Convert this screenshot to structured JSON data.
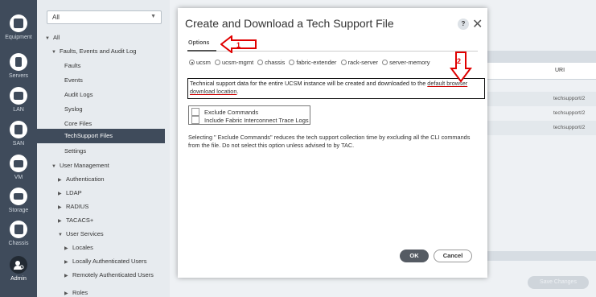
{
  "rail": {
    "items": [
      {
        "label": "Equipment",
        "icon": "equipment-icon"
      },
      {
        "label": "Servers",
        "icon": "servers-icon"
      },
      {
        "label": "LAN",
        "icon": "lan-icon"
      },
      {
        "label": "SAN",
        "icon": "san-icon"
      },
      {
        "label": "VM",
        "icon": "vm-icon"
      },
      {
        "label": "Storage",
        "icon": "storage-icon"
      },
      {
        "label": "Chassis",
        "icon": "chassis-icon"
      },
      {
        "label": "Admin",
        "icon": "admin-icon"
      }
    ]
  },
  "nav": {
    "filter_value": "All",
    "tree": [
      {
        "label": "All",
        "expanded": true
      },
      {
        "label": "Faults, Events and Audit Log",
        "expanded": true
      },
      {
        "label": "Faults"
      },
      {
        "label": "Events"
      },
      {
        "label": "Audit Logs"
      },
      {
        "label": "Syslog"
      },
      {
        "label": "Core Files"
      },
      {
        "label": "TechSupport Files",
        "selected": true
      },
      {
        "label": "Settings"
      },
      {
        "label": "User Management",
        "expanded": true
      },
      {
        "label": "Authentication",
        "expanded": false
      },
      {
        "label": "LDAP",
        "expanded": false
      },
      {
        "label": "RADIUS",
        "expanded": false
      },
      {
        "label": "TACACS+",
        "expanded": false
      },
      {
        "label": "User Services",
        "expanded": true
      },
      {
        "label": "Locales",
        "expanded": false
      },
      {
        "label": "Locally Authenticated Users",
        "expanded": false
      },
      {
        "label": "Remotely Authenticated Users",
        "expanded": false
      },
      {
        "label": "Roles",
        "expanded": false
      }
    ]
  },
  "background": {
    "uri_header": "URI",
    "uri_rows": [
      "techsupport/2",
      "techsupport/2",
      "techsupport/2"
    ],
    "save_button": "Save Changes"
  },
  "dialog": {
    "title": "Create and Download a Tech Support File",
    "help_label": "?",
    "close_label": "✕",
    "tab": "Options",
    "radios": [
      {
        "label": "ucsm",
        "selected": true
      },
      {
        "label": "ucsm-mgmt",
        "selected": false
      },
      {
        "label": "chassis",
        "selected": false
      },
      {
        "label": "fabric-extender",
        "selected": false
      },
      {
        "label": "rack-server",
        "selected": false
      },
      {
        "label": "server-memory",
        "selected": false
      }
    ],
    "info_text": "Technical support data for the entire UCSM instance will be created and downloaded to the ",
    "info_link_1": "default browser",
    "info_link_2": "download location",
    "info_end": ".",
    "checkboxes": [
      {
        "label": "Exclude Commands",
        "checked": false
      },
      {
        "label": "Include Fabric Interconnect Trace Logs",
        "checked": false
      }
    ],
    "note": "Selecting \" Exclude Commands\" reduces the tech support collection time by excluding all the CLI commands from the file. Do not select this option unless advised to by TAC.",
    "ok_label": "OK",
    "cancel_label": "Cancel"
  },
  "annotations": {
    "arrow1_label": "1",
    "arrow2_label": "2",
    "color": "#e00000"
  }
}
